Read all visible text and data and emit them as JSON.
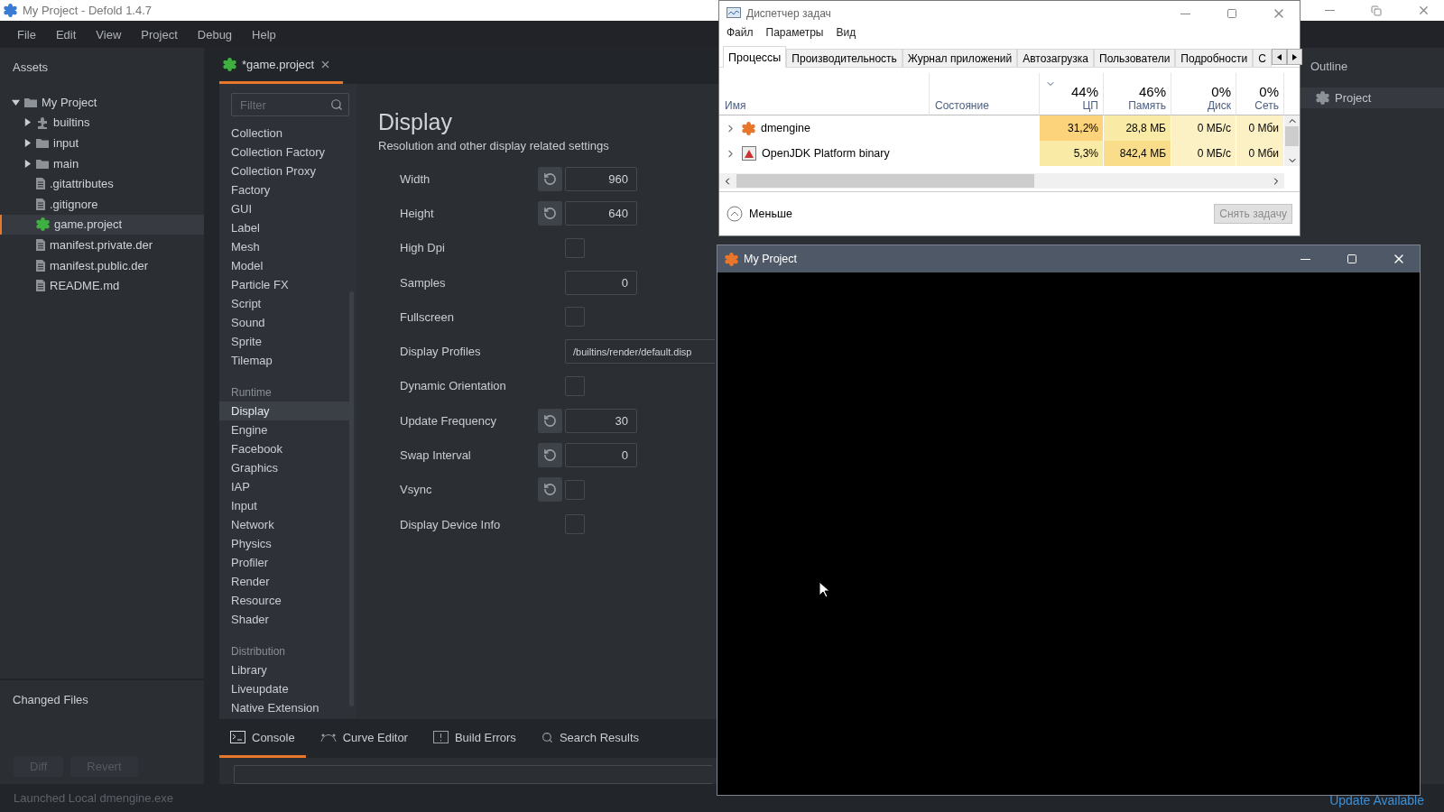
{
  "editor": {
    "title": "My Project - Defold 1.4.7",
    "menu": [
      "File",
      "Edit",
      "View",
      "Project",
      "Debug",
      "Help"
    ],
    "assets": {
      "title": "Assets",
      "tree": [
        {
          "label": "My Project",
          "kind": "folder",
          "expanded": true,
          "selected": false,
          "children": [
            {
              "label": "builtins",
              "kind": "library",
              "expanded": false,
              "selected": false
            },
            {
              "label": "input",
              "kind": "folder",
              "expanded": false,
              "selected": false
            },
            {
              "label": "main",
              "kind": "folder",
              "expanded": false,
              "selected": false
            },
            {
              "label": ".gitattributes",
              "kind": "file",
              "selected": false
            },
            {
              "label": ".gitignore",
              "kind": "file",
              "selected": false
            },
            {
              "label": "game.project",
              "kind": "project",
              "selected": true
            },
            {
              "label": "manifest.private.der",
              "kind": "file",
              "selected": false
            },
            {
              "label": "manifest.public.der",
              "kind": "file",
              "selected": false
            },
            {
              "label": "README.md",
              "kind": "file",
              "selected": false
            }
          ]
        }
      ]
    },
    "changed_files": {
      "title": "Changed Files",
      "buttons": [
        {
          "label": "Diff",
          "disabled": true
        },
        {
          "label": "Revert",
          "disabled": true
        }
      ]
    },
    "tabs": [
      {
        "label": "*game.project",
        "selected": true
      }
    ],
    "filter": {
      "placeholder": "Filter"
    },
    "categories": [
      {
        "items": [
          {
            "label": "Collection",
            "selected": false
          },
          {
            "label": "Collection Factory",
            "selected": false
          },
          {
            "label": "Collection Proxy",
            "selected": false
          },
          {
            "label": "Factory",
            "selected": false
          },
          {
            "label": "GUI",
            "selected": false
          },
          {
            "label": "Label",
            "selected": false
          },
          {
            "label": "Mesh",
            "selected": false
          },
          {
            "label": "Model",
            "selected": false
          },
          {
            "label": "Particle FX",
            "selected": false
          },
          {
            "label": "Script",
            "selected": false
          },
          {
            "label": "Sound",
            "selected": false
          },
          {
            "label": "Sprite",
            "selected": false
          },
          {
            "label": "Tilemap",
            "selected": false
          }
        ]
      },
      {
        "heading": "Runtime",
        "items": [
          {
            "label": "Display",
            "selected": true
          },
          {
            "label": "Engine",
            "selected": false
          },
          {
            "label": "Facebook",
            "selected": false
          },
          {
            "label": "Graphics",
            "selected": false
          },
          {
            "label": "IAP",
            "selected": false
          },
          {
            "label": "Input",
            "selected": false
          },
          {
            "label": "Network",
            "selected": false
          },
          {
            "label": "Physics",
            "selected": false
          },
          {
            "label": "Profiler",
            "selected": false
          },
          {
            "label": "Render",
            "selected": false
          },
          {
            "label": "Resource",
            "selected": false
          },
          {
            "label": "Shader",
            "selected": false
          }
        ]
      },
      {
        "heading": "Distribution",
        "items": [
          {
            "label": "Library",
            "selected": false
          },
          {
            "label": "Liveupdate",
            "selected": false
          },
          {
            "label": "Native Extension",
            "selected": false
          }
        ]
      }
    ],
    "form": {
      "title": "Display",
      "description": "Resolution and other display related settings",
      "fields": [
        {
          "label": "Width",
          "kind": "number",
          "value": "960",
          "resettable": true
        },
        {
          "label": "Height",
          "kind": "number",
          "value": "640",
          "resettable": true
        },
        {
          "label": "High Dpi",
          "kind": "checkbox",
          "checked": false,
          "resettable": false
        },
        {
          "label": "Samples",
          "kind": "number",
          "value": "0",
          "resettable": false
        },
        {
          "label": "Fullscreen",
          "kind": "checkbox",
          "checked": false,
          "resettable": false
        },
        {
          "label": "Display Profiles",
          "kind": "text",
          "value": "/builtins/render/default.disp",
          "resettable": false
        },
        {
          "label": "Dynamic Orientation",
          "kind": "checkbox",
          "checked": false,
          "resettable": false
        },
        {
          "label": "Update Frequency",
          "kind": "number",
          "value": "30",
          "resettable": true
        },
        {
          "label": "Swap Interval",
          "kind": "number",
          "value": "0",
          "resettable": true
        },
        {
          "label": "Vsync",
          "kind": "checkbox",
          "checked": false,
          "resettable": true
        },
        {
          "label": "Display Device Info",
          "kind": "checkbox",
          "checked": false,
          "resettable": false
        }
      ]
    },
    "bottom_tabs": [
      {
        "label": "Console",
        "selected": true
      },
      {
        "label": "Curve Editor",
        "selected": false
      },
      {
        "label": "Build Errors",
        "selected": false
      },
      {
        "label": "Search Results",
        "selected": false
      }
    ],
    "outline": {
      "title": "Outline",
      "items": [
        {
          "label": "Project",
          "selected": true
        }
      ]
    },
    "status_bar": {
      "message": "Launched Local dmengine.exe",
      "link": "Update Available"
    }
  },
  "task_manager": {
    "title": "Диспетчер задач",
    "menu": [
      "Файл",
      "Параметры",
      "Вид"
    ],
    "tabs": [
      {
        "label": "Процессы",
        "selected": true
      },
      {
        "label": "Производительность",
        "selected": false
      },
      {
        "label": "Журнал приложений",
        "selected": false
      },
      {
        "label": "Автозагрузка",
        "selected": false
      },
      {
        "label": "Пользователи",
        "selected": false
      },
      {
        "label": "Подробности",
        "selected": false
      },
      {
        "label": "С",
        "selected": false
      }
    ],
    "columns": [
      {
        "label": "Имя",
        "sorted": false
      },
      {
        "label": "Состояние",
        "sorted": false
      },
      {
        "total": "44%",
        "label": "ЦП",
        "sorted": true
      },
      {
        "total": "46%",
        "label": "Память",
        "sorted": false
      },
      {
        "total": "0%",
        "label": "Диск",
        "sorted": false
      },
      {
        "total": "0%",
        "label": "Сеть",
        "sorted": false
      }
    ],
    "rows": [
      {
        "cells": [
          {
            "text": "dmengine"
          },
          {
            "text": ""
          },
          {
            "text": "31,2%",
            "color": "#fcd27a"
          },
          {
            "text": "28,8 МБ",
            "color": "#f9eba6"
          },
          {
            "text": "0 МБ/с",
            "color": "#fcf1c4"
          },
          {
            "text": "0 Мби",
            "color": "#fcf1c4"
          }
        ]
      },
      {
        "cells": [
          {
            "text": "OpenJDK Platform binary"
          },
          {
            "text": ""
          },
          {
            "text": "5,3%",
            "color": "#f9eba6"
          },
          {
            "text": "842,4 МБ",
            "color": "#fadd8a"
          },
          {
            "text": "0 МБ/с",
            "color": "#fcf1c4"
          },
          {
            "text": "0 Мби",
            "color": "#fcf1c4"
          }
        ]
      }
    ],
    "fewer": "Меньше",
    "end_task": {
      "label": "Снять задачу",
      "disabled": true
    }
  },
  "game_window": {
    "title": "My Project"
  }
}
